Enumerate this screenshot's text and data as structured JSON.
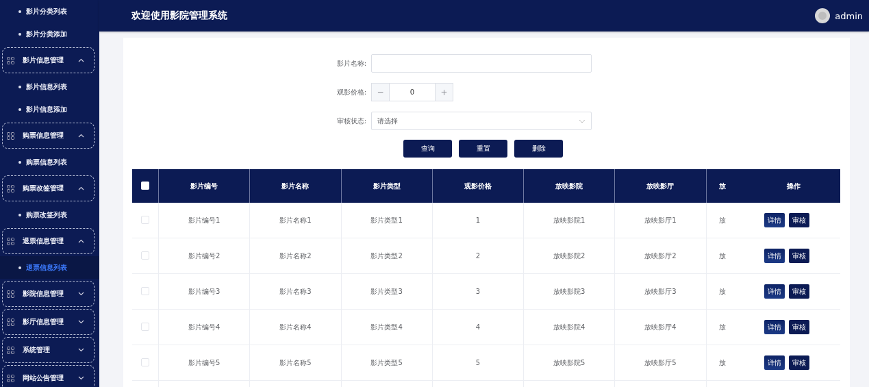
{
  "header": {
    "title": "欢迎使用影院管理系统",
    "user": "admin"
  },
  "sidebar": {
    "items": [
      {
        "kind": "sub",
        "label": "影片分类列表",
        "selected": false
      },
      {
        "kind": "sub",
        "label": "影片分类添加",
        "selected": false
      },
      {
        "kind": "group",
        "label": "影片信息管理",
        "expanded": true
      },
      {
        "kind": "sub",
        "label": "影片信息列表",
        "selected": false
      },
      {
        "kind": "sub",
        "label": "影片信息添加",
        "selected": false
      },
      {
        "kind": "group",
        "label": "购票信息管理",
        "expanded": true
      },
      {
        "kind": "sub",
        "label": "购票信息列表",
        "selected": false
      },
      {
        "kind": "group",
        "label": "购票改签管理",
        "expanded": true
      },
      {
        "kind": "sub",
        "label": "购票改签列表",
        "selected": false
      },
      {
        "kind": "group",
        "label": "退票信息管理",
        "expanded": true
      },
      {
        "kind": "sub",
        "label": "退票信息列表",
        "selected": true
      },
      {
        "kind": "group",
        "label": "影院信息管理",
        "expanded": false
      },
      {
        "kind": "group",
        "label": "影厅信息管理",
        "expanded": false
      },
      {
        "kind": "group",
        "label": "系统管理",
        "expanded": false
      },
      {
        "kind": "group",
        "label": "网站公告管理",
        "expanded": false
      }
    ]
  },
  "search": {
    "fields": [
      {
        "kind": "text",
        "label": "影片名称:"
      },
      {
        "kind": "number",
        "label": "观影价格:",
        "value": "0",
        "minus": "−",
        "plus": "+"
      },
      {
        "kind": "select",
        "label": "审核状态:",
        "placeholder": "请选择"
      }
    ],
    "buttons": [
      "查询",
      "重置",
      "删除"
    ]
  },
  "table": {
    "select_all": {
      "checked": false
    },
    "columns": [
      "影片编号",
      "影片名称",
      "影片类型",
      "观影价格",
      "放映影院",
      "放映影厅",
      "放"
    ],
    "action_column": "操作",
    "rows": [
      {
        "checked": false,
        "cells": [
          "影片编号1",
          "影片名称1",
          "影片类型1",
          "1",
          "放映影院1",
          "放映影厅1",
          "放"
        ],
        "actions": [
          "详情",
          "审核"
        ]
      },
      {
        "checked": false,
        "cells": [
          "影片编号2",
          "影片名称2",
          "影片类型2",
          "2",
          "放映影院2",
          "放映影厅2",
          "放"
        ],
        "actions": [
          "详情",
          "审核"
        ]
      },
      {
        "checked": false,
        "cells": [
          "影片编号3",
          "影片名称3",
          "影片类型3",
          "3",
          "放映影院3",
          "放映影厅3",
          "放"
        ],
        "actions": [
          "详情",
          "审核"
        ]
      },
      {
        "checked": false,
        "cells": [
          "影片编号4",
          "影片名称4",
          "影片类型4",
          "4",
          "放映影院4",
          "放映影厅4",
          "放"
        ],
        "actions": [
          "详情",
          "审核"
        ]
      },
      {
        "checked": false,
        "cells": [
          "影片编号5",
          "影片名称5",
          "影片类型5",
          "5",
          "放映影院5",
          "放映影厅5",
          "放"
        ],
        "actions": [
          "详情",
          "审核"
        ]
      }
    ]
  }
}
